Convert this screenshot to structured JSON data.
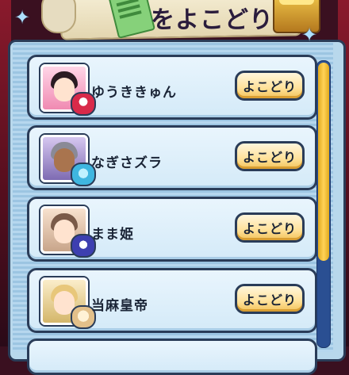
{
  "header": {
    "banner_text": "をよこどり!"
  },
  "list": {
    "items": [
      {
        "name": "ゆうききゅん",
        "button_label": "よこどり"
      },
      {
        "name": "なぎさズラ",
        "button_label": "よこどり"
      },
      {
        "name": "まま姫",
        "button_label": "よこどり"
      },
      {
        "name": "当麻皇帝",
        "button_label": "よこどり"
      }
    ]
  },
  "icons": {
    "sparkle_left": "sparkle-icon",
    "sparkle_right": "sparkle-icon",
    "ticket": "ticket-icon",
    "chest": "treasure-chest-icon"
  },
  "colors": {
    "panel_border": "#2a3c58",
    "button_fill": "#ffe19a",
    "scrollbar": "#2a4f92",
    "scroll_thumb": "#ffd257"
  },
  "scroll": {
    "thumb_fraction": 0.69
  }
}
